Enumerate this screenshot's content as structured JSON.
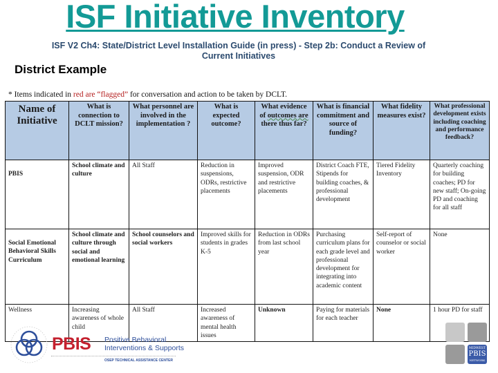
{
  "header": {
    "title": "ISF Initiative Inventory",
    "subtitle_line1": "ISF V2 Ch4: State/District Level Installation Guide (in press) - Step 2b: Conduct a Review of",
    "subtitle_line2": "Current Initiatives",
    "section_label": "District Example"
  },
  "note": {
    "prefix": "* Items indicated in ",
    "red_part": "red are “flagged”",
    "suffix": " for conversation and action to be taken by DCLT."
  },
  "colors": {
    "title": "#139a96",
    "header_fill": "#b6cbe4",
    "flag_red": "#a51c1c",
    "pbis_red": "#c4202e",
    "pbis_blue": "#2e4f9b"
  },
  "table": {
    "columns": [
      "Name of Initiative",
      "What is connection to DCLT mission?",
      "What personnel are involved in the implementation ?",
      "What is expected outcome?",
      "What evidence of outcomes are there thus far?",
      "What is financial commitment and source of funding?",
      "What fidelity measures exist?",
      "What professional development exists including coaching and performance feedback?"
    ],
    "rows": [
      {
        "cells": [
          {
            "text": "PBIS",
            "flagged": true
          },
          {
            "text": "School climate and culture",
            "flagged": true
          },
          {
            "text": "All Staff",
            "flagged": false
          },
          {
            "text": "Reduction in suspensions, ODRs, restrictive placements",
            "flagged": false
          },
          {
            "text": "Improved suspension, ODR and restrictive placements",
            "flagged": false
          },
          {
            "text": "District Coach FTE, Stipends for building coaches, & professional development",
            "flagged": false
          },
          {
            "text": "Tiered Fidelity Inventory",
            "flagged": false
          },
          {
            "text": "Quarterly coaching for building coaches; PD for new staff; On-going PD and coaching for all staff",
            "flagged": false
          }
        ]
      },
      {
        "cells": [
          {
            "text": "Social Emotional Behavioral Skills Curriculum",
            "flagged": true
          },
          {
            "text": "School climate and culture through social and emotional learning",
            "flagged": true
          },
          {
            "text": "School counselors and social workers",
            "flagged": true
          },
          {
            "text": "Improved skills for students in grades K-5",
            "flagged": false
          },
          {
            "text": "Reduction in ODRs from last school year",
            "flagged": false
          },
          {
            "text": "Purchasing curriculum plans for each grade level and professional development for integrating into academic content",
            "flagged": false
          },
          {
            "text": "Self-report of counselor or social worker",
            "flagged": false
          },
          {
            "text": "None",
            "flagged": false
          }
        ]
      },
      {
        "cells": [
          {
            "text": "Wellness",
            "flagged": false
          },
          {
            "text": "Increasing awareness of whole child",
            "flagged": false
          },
          {
            "text": "All Staff",
            "flagged": false
          },
          {
            "text": "Increased awareness of mental health issues",
            "flagged": false
          },
          {
            "text": "Unknown",
            "flagged": true
          },
          {
            "text": "Paying for materials for each teacher",
            "flagged": false
          },
          {
            "text": "None",
            "flagged": true
          },
          {
            "text": "1 hour PD for staff",
            "flagged": false
          }
        ]
      }
    ]
  },
  "footer": {
    "logo_acronym": "PBIS",
    "logo_line1": "Positive Behavioral",
    "logo_line2": "Interventions & Supports",
    "logo_line3": "OSEP TECHNICAL ASSISTANCE CENTER",
    "badge_top": "MIDWEST",
    "badge_main": "PBIS",
    "badge_bottom": "NETWORK"
  }
}
